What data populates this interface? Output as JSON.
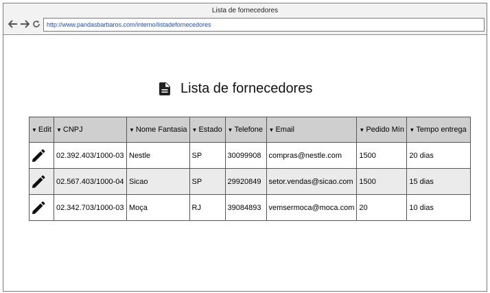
{
  "window": {
    "title": "Lista de fornecedores"
  },
  "nav": {
    "back_icon": "arrow-left-icon",
    "forward_icon": "arrow-right-icon",
    "reload_icon": "reload-icon"
  },
  "address_bar": {
    "url": "http://www.pandasbarbaros.com/interno/listadefornecedores"
  },
  "page": {
    "title": "Lista de fornecedores",
    "title_icon": "document-icon"
  },
  "table": {
    "columns": [
      "Edit",
      "CNPJ",
      "Nome Fantasia",
      "Estado",
      "Telefone",
      "Email",
      "Pedido Mín",
      "Tempo entrega"
    ],
    "sort_icon": "sort-down-icon",
    "edit_icon": "pencil-icon",
    "rows": [
      {
        "cnpj": "02.392.403/1000-03",
        "nome": "Nestle",
        "estado": "SP",
        "telefone": "30099908",
        "email": "compras@nestle.com",
        "pedido": "1500",
        "tempo": "20 dias"
      },
      {
        "cnpj": "02.567.403/1000-04",
        "nome": "Sicao",
        "estado": "SP",
        "telefone": "29920849",
        "email": "setor.vendas@sicao.com",
        "pedido": "1500",
        "tempo": "15 dias"
      },
      {
        "cnpj": "02.342.703/1000-03",
        "nome": "Moça",
        "estado": "RJ",
        "telefone": "39084893",
        "email": "vemsermoca@moca.com",
        "pedido": "20",
        "tempo": "10 dias"
      }
    ]
  }
}
